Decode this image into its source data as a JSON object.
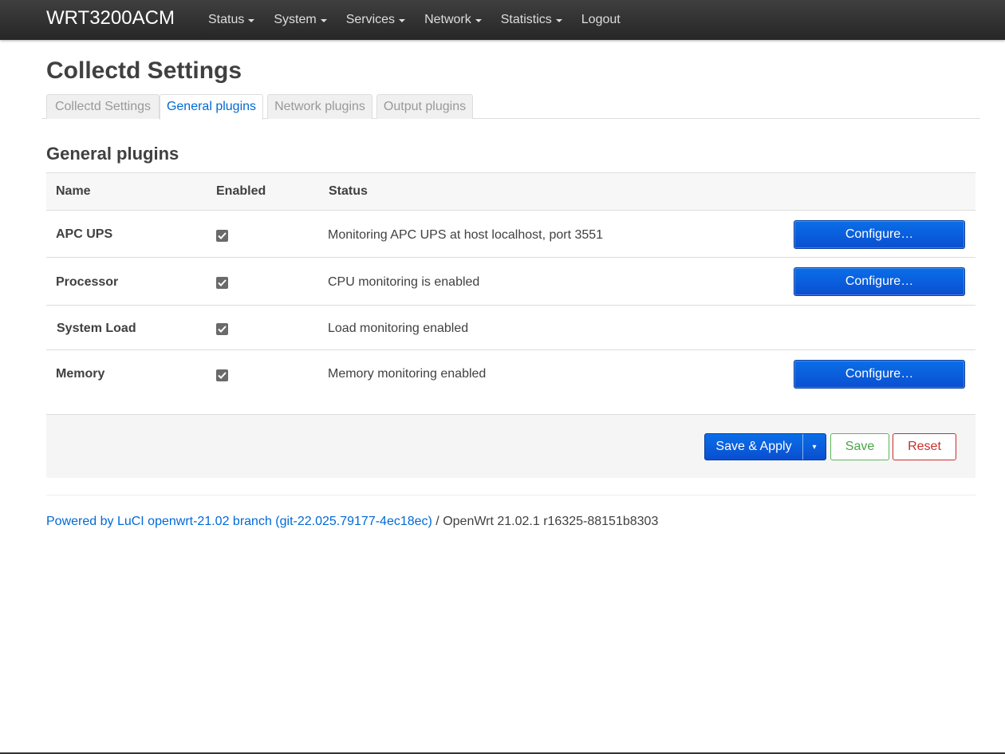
{
  "navbar": {
    "brand": "WRT3200ACM",
    "menu": [
      {
        "label": "Status",
        "has_dropdown": true
      },
      {
        "label": "System",
        "has_dropdown": true
      },
      {
        "label": "Services",
        "has_dropdown": true
      },
      {
        "label": "Network",
        "has_dropdown": true
      },
      {
        "label": "Statistics",
        "has_dropdown": true
      },
      {
        "label": "Logout",
        "has_dropdown": false
      }
    ]
  },
  "page": {
    "title": "Collectd Settings",
    "tabs": [
      {
        "label": "Collectd Settings",
        "active": false
      },
      {
        "label": "General plugins",
        "active": true
      },
      {
        "label": "Network plugins",
        "active": false
      },
      {
        "label": "Output plugins",
        "active": false
      }
    ],
    "section_title": "General plugins"
  },
  "table": {
    "headers": {
      "name": "Name",
      "enabled": "Enabled",
      "status": "Status"
    },
    "rows": [
      {
        "name": "APC UPS",
        "enabled": true,
        "status": "Monitoring APC UPS at host localhost, port 3551",
        "configure": "Configure…"
      },
      {
        "name": "Processor",
        "enabled": true,
        "status": "CPU monitoring is enabled",
        "configure": "Configure…"
      },
      {
        "name": "System Load",
        "enabled": true,
        "status": "Load monitoring enabled",
        "configure": ""
      },
      {
        "name": "Memory",
        "enabled": true,
        "status": "Memory monitoring enabled",
        "configure": "Configure…"
      }
    ]
  },
  "actions": {
    "save_apply": "Save & Apply",
    "save_apply_dropdown": "▾",
    "save": "Save",
    "reset": "Reset"
  },
  "footer": {
    "link_text": "Powered by LuCI openwrt-21.02 branch (git-22.025.79177-4ec18ec)",
    "separator": " / ",
    "version": "OpenWrt 21.02.1 r16325-88151b8303"
  },
  "colors": {
    "accent": "#0069d6",
    "primary_button": "#0a5fe0",
    "save_green": "#46a546",
    "reset_red": "#c9302c",
    "navbar": "#2f2f2f"
  }
}
